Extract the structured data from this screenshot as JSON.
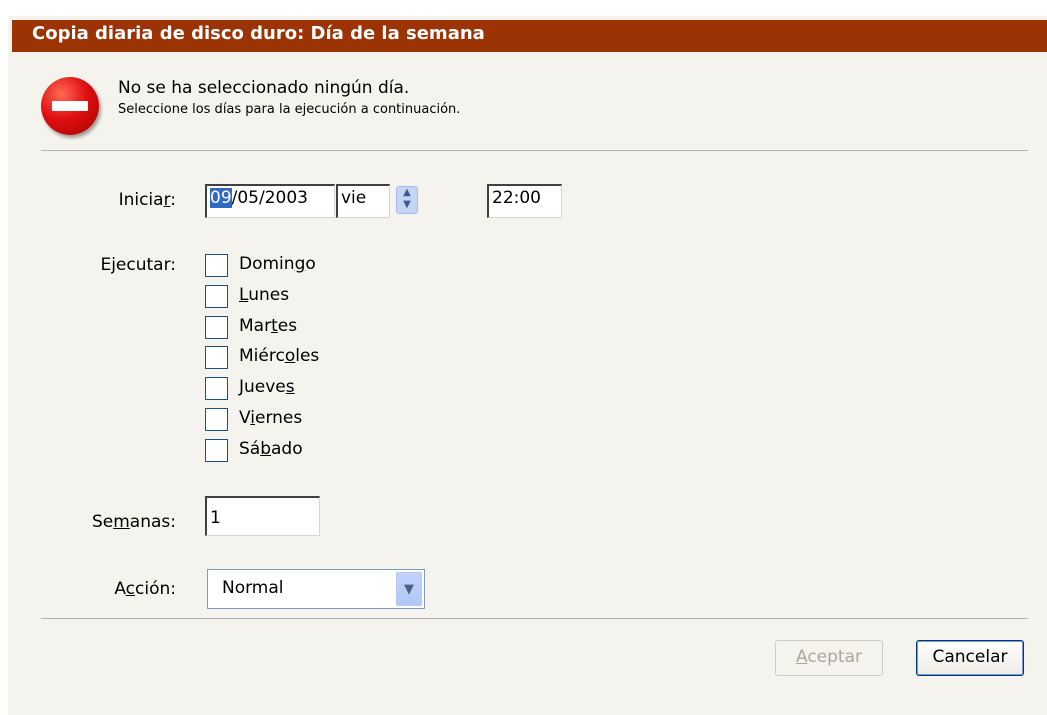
{
  "window": {
    "title": "Copia diaria de disco duro: Día de la semana"
  },
  "error": {
    "icon": "error-icon",
    "title": "No se ha seleccionado ningún día.",
    "detail": "Seleccione los días para la ejecución a continuación."
  },
  "start": {
    "label_pre": "Inicia",
    "label_mnemonic": "r",
    "label_post": ":",
    "date_day": "09",
    "date_rest": "/05/2003",
    "weekday": "vie",
    "time": "22:00"
  },
  "run": {
    "label": "Ejecutar:",
    "days": [
      {
        "pre": "Domin",
        "mn": "g",
        "post": "o",
        "checked": false
      },
      {
        "pre": "",
        "mn": "L",
        "post": "unes",
        "checked": false
      },
      {
        "pre": "Mar",
        "mn": "t",
        "post": "es",
        "checked": false
      },
      {
        "pre": "Miérc",
        "mn": "o",
        "post": "les",
        "checked": false
      },
      {
        "pre": "Jueve",
        "mn": "s",
        "post": "",
        "checked": false
      },
      {
        "pre": "V",
        "mn": "i",
        "post": "ernes",
        "checked": false
      },
      {
        "pre": "Sá",
        "mn": "b",
        "post": "ado",
        "checked": false
      }
    ]
  },
  "weeks": {
    "label_pre": "Se",
    "label_mnemonic": "m",
    "label_post": "anas:",
    "value": "1"
  },
  "action": {
    "label_pre": "A",
    "label_mnemonic": "c",
    "label_post": "ción:",
    "value": "Normal"
  },
  "buttons": {
    "ok_mnemonic": "A",
    "ok_rest": "ceptar",
    "ok_enabled": false,
    "cancel": "Cancelar"
  },
  "colors": {
    "titlebar": "#9c3305",
    "highlight": "#316ac5"
  }
}
